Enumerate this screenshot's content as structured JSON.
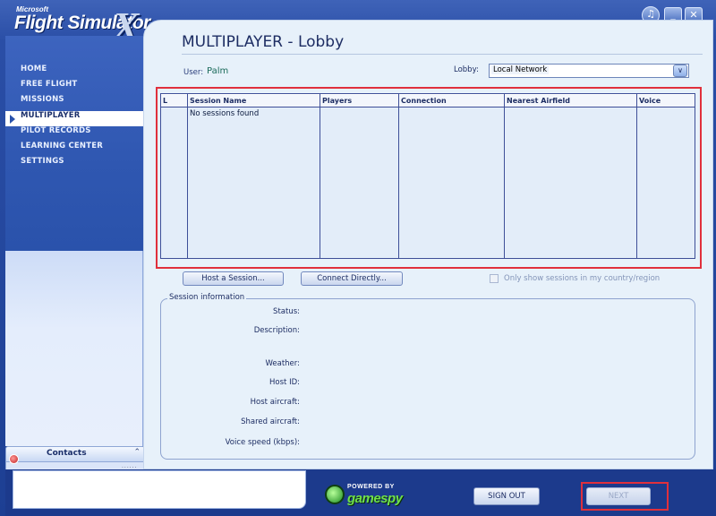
{
  "app": {
    "logo_microsoft": "Microsoft",
    "logo_title": "Flight Simulator",
    "logo_x": "X"
  },
  "window_controls": [
    {
      "name": "sound-toggle",
      "glyph": "♫"
    },
    {
      "name": "minimize",
      "glyph": "_"
    },
    {
      "name": "close",
      "glyph": "✕"
    }
  ],
  "sidebar": {
    "items": [
      {
        "label": "HOME",
        "active": false
      },
      {
        "label": "FREE FLIGHT",
        "active": false
      },
      {
        "label": "MISSIONS",
        "active": false
      },
      {
        "label": "MULTIPLAYER",
        "active": true
      },
      {
        "label": "PILOT RECORDS",
        "active": false
      },
      {
        "label": "LEARNING CENTER",
        "active": false
      },
      {
        "label": "SETTINGS",
        "active": false
      }
    ],
    "contacts_label": "Contacts",
    "contacts_dots": "......"
  },
  "page": {
    "title": "MULTIPLAYER - Lobby",
    "user_label": "User:",
    "user_value": "Palm",
    "lobby_label": "Lobby:",
    "lobby_value": "Local Network"
  },
  "session_table": {
    "columns": [
      "L",
      "Session Name",
      "Players",
      "Connection",
      "Nearest Airfield",
      "Voice"
    ],
    "empty_message": "No sessions found"
  },
  "actions": {
    "host_session": "Host a Session...",
    "connect_directly": "Connect Directly...",
    "country_filter_label": "Only show sessions in my country/region",
    "country_filter_checked": false
  },
  "session_info": {
    "title": "Session information",
    "fields": [
      "Status:",
      "Description:",
      "Weather:",
      "Host ID:",
      "Host aircraft:",
      "Shared aircraft:",
      "Voice speed (kbps):"
    ]
  },
  "footer": {
    "powered_by": "POWERED BY",
    "gamespy": "gamespy",
    "sign_out": "SIGN OUT",
    "next": "NEXT"
  },
  "colors": {
    "frame_blue": "#1e3f8c",
    "panel_bg": "#e7f1fa",
    "highlight_red": "#e0303c",
    "table_border": "#3e4f98"
  }
}
